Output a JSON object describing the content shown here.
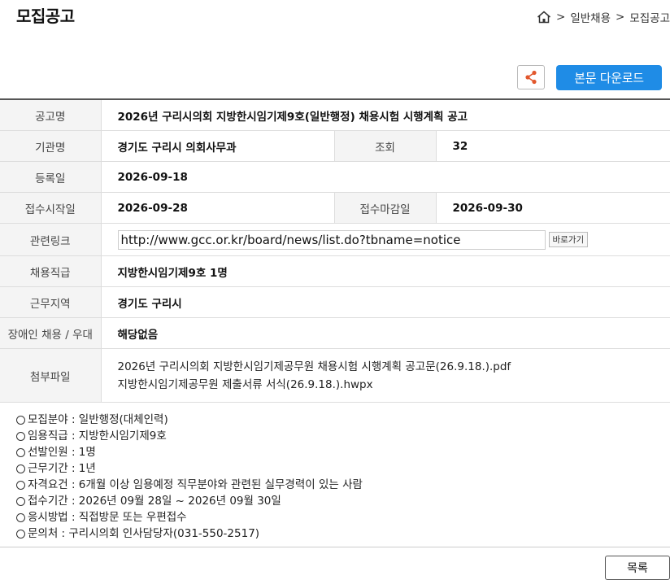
{
  "header": {
    "title": "모집공고",
    "breadcrumb": [
      "일반채용",
      "모집공고"
    ]
  },
  "toolbar": {
    "download_label": "본문 다운로드",
    "share_icon": "share-icon",
    "accent_color": "#1f8ce6"
  },
  "info": {
    "title_label": "공고명",
    "title_value": "2026년 구리시의회 지방한시임기제9호(일반행정) 채용시험 시행계획 공고",
    "org_label": "기관명",
    "org_value": "경기도 구리시 의회사무과",
    "views_label": "조회",
    "views_value": "32",
    "reg_label": "등록일",
    "reg_value": "2026-09-18",
    "start_label": "접수시작일",
    "start_value": "2026-09-28",
    "end_label": "접수마감일",
    "end_value": "2026-09-30",
    "link_label": "관련링크",
    "link_value": "http://www.gcc.or.kr/board/news/list.do?tbname=notice",
    "link_go_label": "바로가기",
    "grade_label": "채용직급",
    "grade_value": "지방한시임기제9호 1명",
    "region_label": "근무지역",
    "region_value": "경기도 구리시",
    "disability_label": "장애인 채용 / 우대",
    "disability_value": "해당없음",
    "files_label": "첨부파일",
    "files": [
      "2026년 구리시의회 지방한시임기제공무원 채용시험 시행계획 공고문(26.9.18.).pdf",
      "지방한시임기제공무원 제출서류 서식(26.9.18.).hwpx"
    ]
  },
  "details": [
    "모집분야 : 일반행정(대체인력)",
    "임용직급 : 지방한시임기제9호",
    "선발인원 : 1명",
    "근무기간 : 1년",
    "자격요건 : 6개월 이상 임용예정 직무분야와 관련된 실무경력이 있는 사람",
    "접수기간 : 2026년 09월 28일 ~ 2026년 09월 30일",
    "응시방법 : 직접방문 또는 우편접수",
    "문의처 : 구리시의회 인사담당자(031-550-2517)"
  ],
  "footer": {
    "list_label": "목록"
  }
}
